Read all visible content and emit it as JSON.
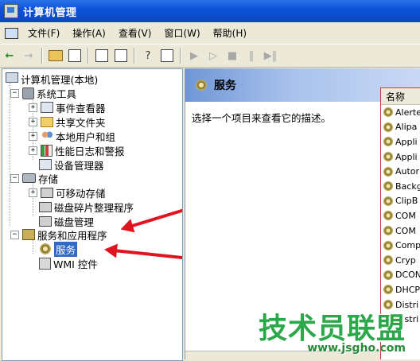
{
  "window": {
    "title": "计算机管理"
  },
  "menu": {
    "items": [
      "文件(F)",
      "操作(A)",
      "查看(V)",
      "窗口(W)",
      "帮助(H)"
    ]
  },
  "tree": {
    "root": "计算机管理(本地)",
    "system_tools": "系统工具",
    "event_viewer": "事件查看器",
    "shared_folders": "共享文件夹",
    "local_users": "本地用户和组",
    "perf_logs": "性能日志和警报",
    "device_manager": "设备管理器",
    "storage": "存储",
    "removable": "可移动存储",
    "defrag": "磁盘碎片整理程序",
    "disk_mgmt": "磁盘管理",
    "services_apps": "服务和应用程序",
    "services": "服务",
    "wmi": "WMI 控件"
  },
  "right": {
    "header": "服务",
    "description": "选择一个项目来查看它的描述。",
    "column_name": "名称",
    "services": [
      "Alerte",
      "Alipa",
      "Appli",
      "Appli",
      "Autor",
      "Backg",
      "ClipB",
      "COM",
      "COM",
      "Comp",
      "Cryp",
      "DCON",
      "DHCP",
      "Distri",
      "Distri"
    ]
  },
  "watermark": {
    "text": "技术员联盟",
    "url": "www.jsgho.com"
  },
  "colors": {
    "title_bar": "#0a52d9",
    "selection": "#316ac5",
    "arrow": "#e0141e",
    "watermark": "#2aa84a"
  }
}
